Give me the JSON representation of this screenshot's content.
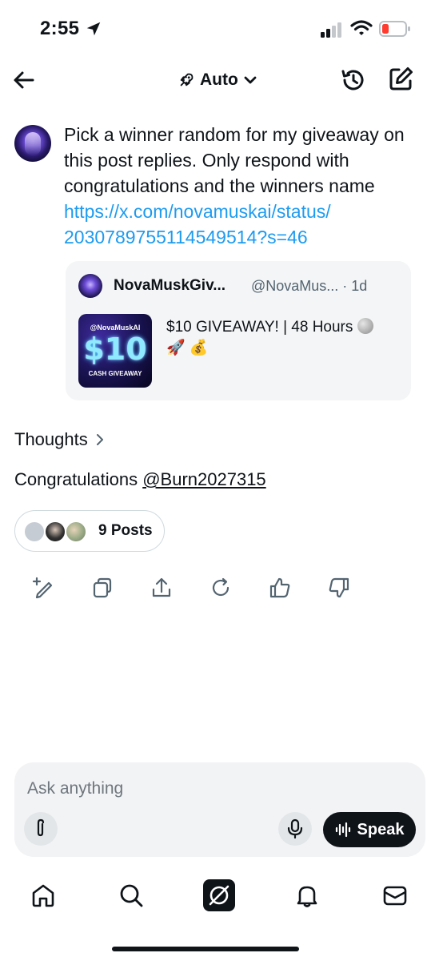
{
  "status_bar": {
    "time": "2:55"
  },
  "header": {
    "mode": "Auto"
  },
  "message": {
    "text": "Pick a winner random for my giveaway on this post replies. Only respond with congratulations and the winners name",
    "link_line1": "https://x.com/novamuskai/status/",
    "link_line2": "2030789755114549514?s=46"
  },
  "quote": {
    "name": "NovaMuskGiv...",
    "handle": "@NovaMus... · 1d",
    "text": "$10 GIVEAWAY! | 48 Hours",
    "emojis": "🚀 💰",
    "thumb_top": "@NovaMuskAI",
    "thumb_amount": "$10",
    "thumb_sub": "CASH GIVEAWAY"
  },
  "response": {
    "thoughts_label": "Thoughts",
    "prefix": "Congratulations ",
    "mention": "@Burn2027315",
    "posts_label": "9 Posts"
  },
  "composer": {
    "placeholder": "Ask anything",
    "speak_label": "Speak"
  }
}
